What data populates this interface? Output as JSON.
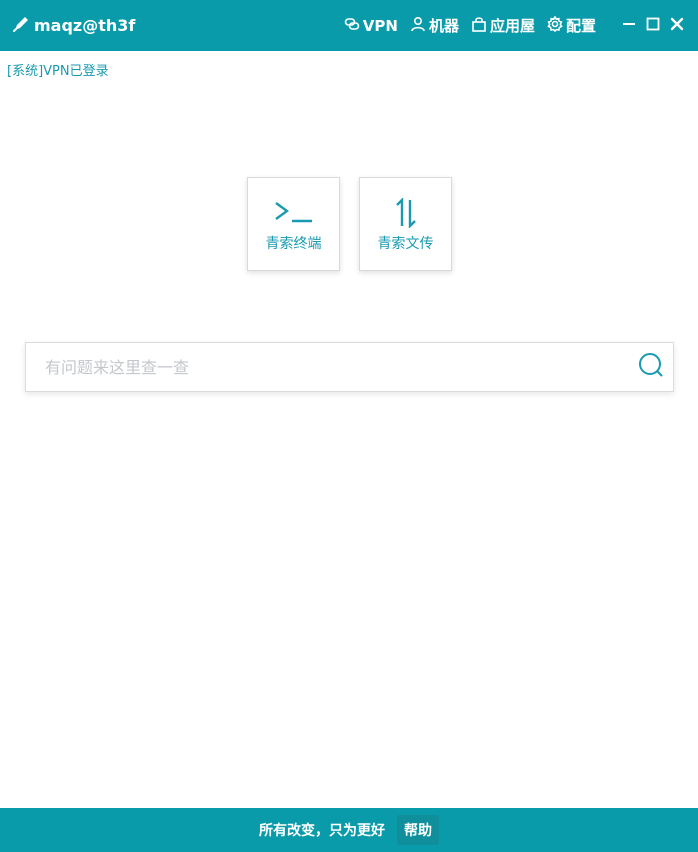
{
  "header": {
    "title": "maqz@th3f",
    "nav": [
      {
        "label": "VPN",
        "icon": "link-icon"
      },
      {
        "label": "机器",
        "icon": "user-icon"
      },
      {
        "label": "应用屋",
        "icon": "bag-icon"
      },
      {
        "label": "配置",
        "icon": "gear-icon"
      }
    ],
    "window_controls": [
      "minimize",
      "maximize",
      "close"
    ]
  },
  "status": {
    "message": "[系统]VPN已登录"
  },
  "tools": [
    {
      "label": "青索终端",
      "icon": "terminal-icon"
    },
    {
      "label": "青索文传",
      "icon": "transfer-icon"
    }
  ],
  "search": {
    "placeholder": "有问题来这里查一查",
    "value": ""
  },
  "footer": {
    "slogan": "所有改变，只为更好",
    "help_label": "帮助"
  },
  "colors": {
    "accent": "#099ba9",
    "link_text": "#1a9ab0",
    "background": "#ffffff"
  }
}
